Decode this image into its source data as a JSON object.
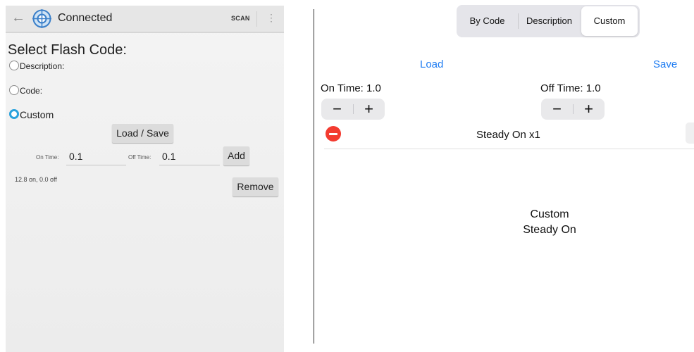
{
  "android": {
    "toolbar": {
      "title": "Connected",
      "scan_label": "SCAN",
      "back_icon": "←",
      "menu_icon": "⋮"
    },
    "heading": "Select Flash Code:",
    "options": [
      {
        "label": "Description:",
        "selected": false
      },
      {
        "label": "Code:",
        "selected": false
      },
      {
        "label": "Custom",
        "selected": true
      }
    ],
    "load_save_label": "Load / Save",
    "on_time_label": "On Time:",
    "on_time_value": "0.1",
    "off_time_label": "Off Time:",
    "off_time_value": "0.1",
    "add_label": "Add",
    "summary": "12.8 on, 0.0 off",
    "remove_label": "Remove",
    "accent_color": "#2aa2dd"
  },
  "ios": {
    "segments": [
      "By Code",
      "Description",
      "Custom"
    ],
    "selected_segment": "Custom",
    "load_label": "Load",
    "save_label": "Save",
    "on_time_label": "On Time: 1.0",
    "off_time_label": "Off Time: 1.0",
    "stepper_minus": "−",
    "stepper_plus": "+",
    "row_label": "Steady On x1",
    "preview_line1": "Custom",
    "preview_line2": "Steady On",
    "link_color": "#1e7cf2",
    "delete_color": "#f33b30"
  }
}
